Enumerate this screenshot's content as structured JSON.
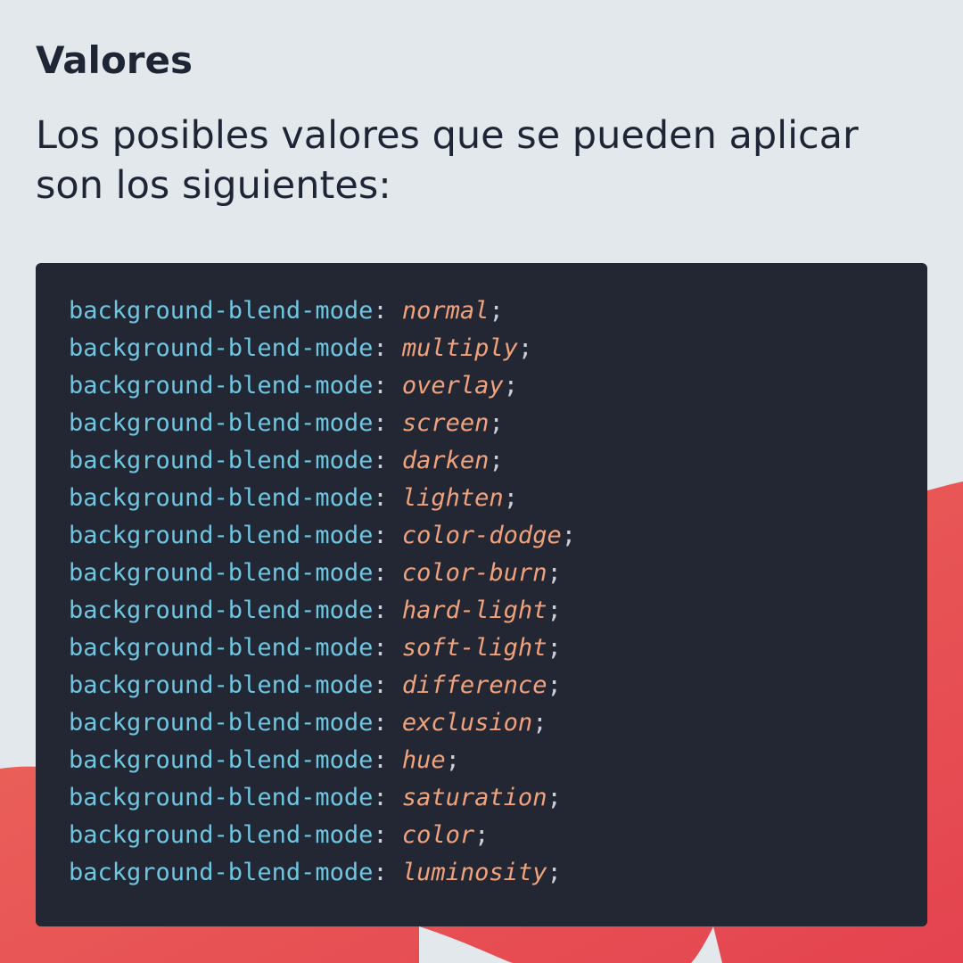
{
  "heading": "Valores",
  "intro": "Los posibles valores que se pueden aplicar son los siguientes:",
  "colors": {
    "background": "#e3e8ed",
    "code_background": "#232734",
    "property": "#6fc6e1",
    "value": "#f0a27c",
    "accent_shape": "#e5535a"
  },
  "code": {
    "lines": [
      {
        "property": "background-blend-mode",
        "value": "normal"
      },
      {
        "property": "background-blend-mode",
        "value": "multiply"
      },
      {
        "property": "background-blend-mode",
        "value": "overlay"
      },
      {
        "property": "background-blend-mode",
        "value": "screen"
      },
      {
        "property": "background-blend-mode",
        "value": "darken"
      },
      {
        "property": "background-blend-mode",
        "value": "lighten"
      },
      {
        "property": "background-blend-mode",
        "value": "color-dodge"
      },
      {
        "property": "background-blend-mode",
        "value": "color-burn"
      },
      {
        "property": "background-blend-mode",
        "value": "hard-light"
      },
      {
        "property": "background-blend-mode",
        "value": "soft-light"
      },
      {
        "property": "background-blend-mode",
        "value": "difference"
      },
      {
        "property": "background-blend-mode",
        "value": "exclusion"
      },
      {
        "property": "background-blend-mode",
        "value": "hue"
      },
      {
        "property": "background-blend-mode",
        "value": "saturation"
      },
      {
        "property": "background-blend-mode",
        "value": "color"
      },
      {
        "property": "background-blend-mode",
        "value": "luminosity"
      }
    ]
  }
}
